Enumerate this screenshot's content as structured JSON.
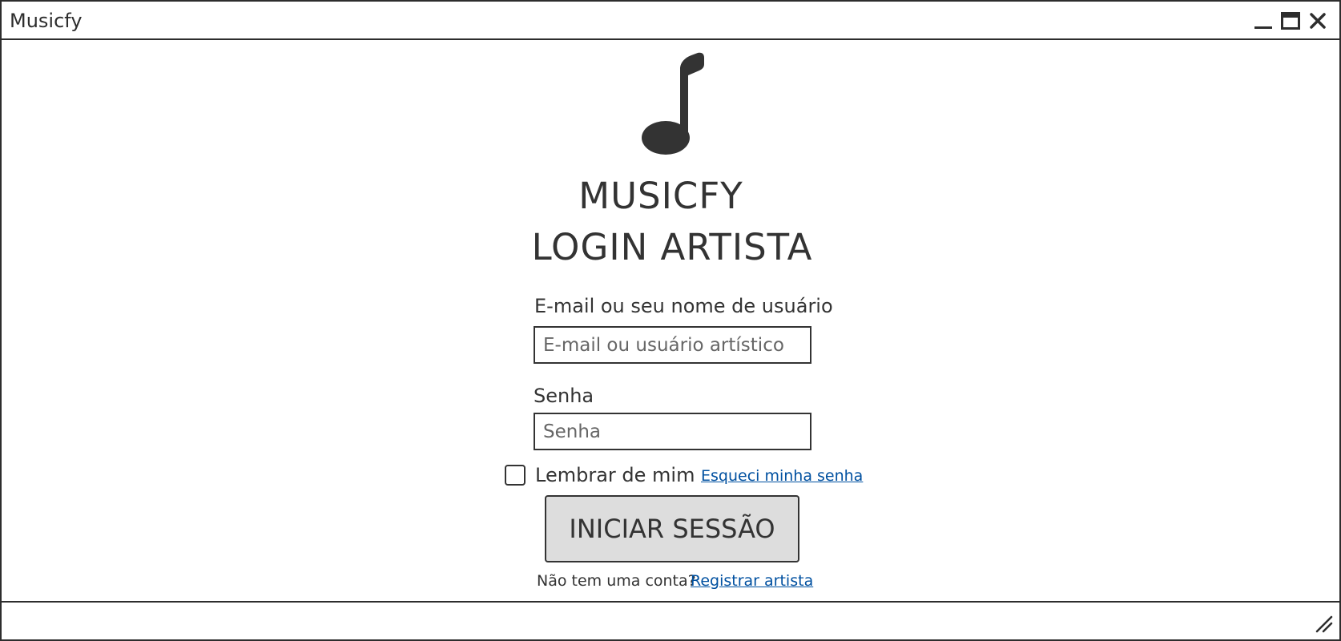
{
  "window": {
    "title": "Musicfy",
    "controls": [
      "minimize-icon",
      "maximize-icon",
      "close-icon"
    ]
  },
  "logo": {
    "icon": "music-note-icon",
    "color": "#333333"
  },
  "heading": {
    "line1": "MUSICFY",
    "line2": "LOGIN ARTISTA"
  },
  "form": {
    "username_label": "E-mail ou seu nome de usuário",
    "username_placeholder": "E-mail ou usuário artístico",
    "username_value": "",
    "password_label": "Senha",
    "password_placeholder": "Senha",
    "password_value": "",
    "remember_label": "Lembrar de mim",
    "remember_checked": false,
    "forgot_link": "Esqueci minha senha",
    "submit_label": "INICIAR SESSÃO",
    "no_account_text": "Não tem uma conta?",
    "register_link": "Registrar artista"
  },
  "colors": {
    "text": "#333333",
    "link": "#0050a0",
    "button_bg": "#dddddd",
    "border": "#2d2d2d"
  }
}
